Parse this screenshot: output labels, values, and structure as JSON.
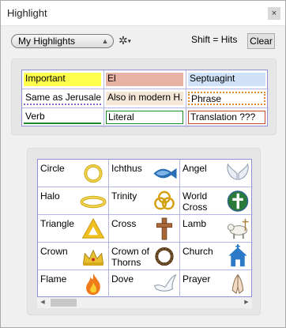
{
  "window": {
    "title": "Highlight",
    "close_glyph": "×"
  },
  "toolbar": {
    "dropdown_value": "My Highlights",
    "settings_icon": "gear-icon",
    "shift_text": "Shift = Hits",
    "clear_label": "Clear"
  },
  "highlights": [
    {
      "label": "Important",
      "style": "fill",
      "color": "#ffff4d",
      "text_color": "#000"
    },
    {
      "label": "El",
      "style": "fill",
      "color": "#e8b3a5",
      "text_color": "#000"
    },
    {
      "label": "Septuagint",
      "style": "fill",
      "color": "#cfe2f7",
      "text_color": "#000"
    },
    {
      "label": "Same as Jerusalem",
      "style": "dotted-underline",
      "color": "#8a6cc8",
      "text_color": "#000"
    },
    {
      "label": "Also in modern H...",
      "style": "fill",
      "color": "#f5e7d8",
      "text_color": "#000"
    },
    {
      "label": "Phrase",
      "style": "dotted-box",
      "color": "#e68a2e",
      "text_color": "#000"
    },
    {
      "label": "Verb",
      "style": "underline",
      "color": "#1a8a2a",
      "text_color": "#000"
    },
    {
      "label": "Literal",
      "style": "box",
      "color": "#1a8a2a",
      "text_color": "#000"
    },
    {
      "label": "Translation ???",
      "style": "box",
      "color": "#c24a2a",
      "text_color": "#000"
    }
  ],
  "symbols": [
    {
      "label": "Circle",
      "icon": "gold-ring-icon"
    },
    {
      "label": "Ichthus",
      "icon": "ichthus-fish-icon"
    },
    {
      "label": "Angel",
      "icon": "angel-wings-icon"
    },
    {
      "label": "Halo",
      "icon": "halo-icon"
    },
    {
      "label": "Trinity",
      "icon": "trinity-knot-icon"
    },
    {
      "label": "World Cross",
      "icon": "globe-cross-icon"
    },
    {
      "label": "Triangle",
      "icon": "triangle-icon"
    },
    {
      "label": "Cross",
      "icon": "wooden-cross-icon"
    },
    {
      "label": "Lamb",
      "icon": "lamb-icon"
    },
    {
      "label": "Crown",
      "icon": "crown-icon"
    },
    {
      "label": "Crown of Thorns",
      "icon": "crown-of-thorns-icon"
    },
    {
      "label": "Church",
      "icon": "church-icon"
    },
    {
      "label": "Flame",
      "icon": "flame-icon"
    },
    {
      "label": "Dove",
      "icon": "dove-icon"
    },
    {
      "label": "Prayer",
      "icon": "praying-hands-icon"
    }
  ],
  "scrollbar": {
    "left_arrow": "◀",
    "right_arrow": "▶"
  }
}
